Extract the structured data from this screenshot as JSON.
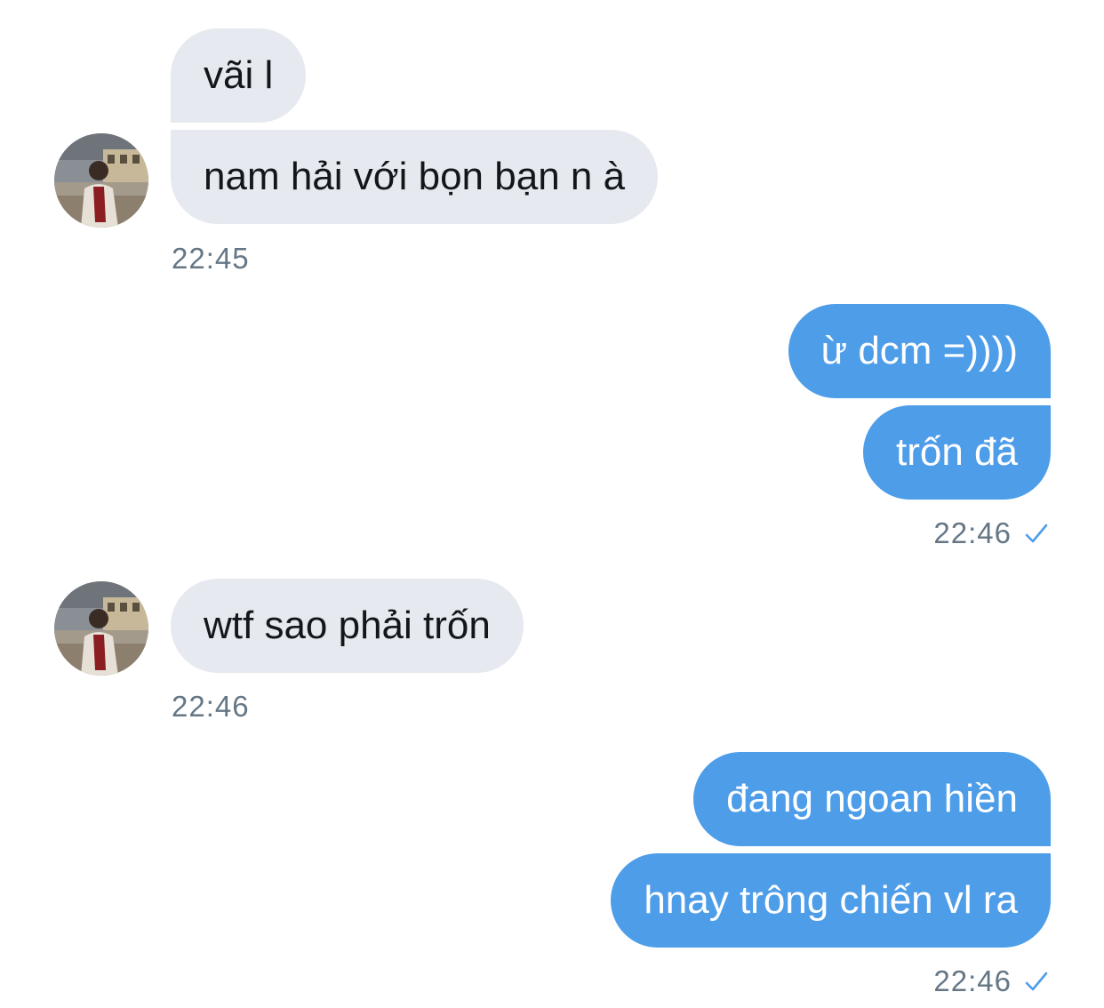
{
  "conversation": {
    "group1": {
      "messages": [
        "vãi l",
        "nam hải với bọn bạn n à"
      ],
      "time": "22:45"
    },
    "group2": {
      "messages": [
        "ừ dcm =))))",
        "trốn đã"
      ],
      "time": "22:46",
      "status_icon": "check-icon"
    },
    "group3": {
      "messages": [
        "wtf sao phải trốn"
      ],
      "time": "22:46"
    },
    "group4": {
      "messages": [
        "đang ngoan hiền",
        "hnay trông chiến vl ra"
      ],
      "time": "22:46",
      "status_icon": "check-icon"
    }
  },
  "colors": {
    "received_bubble": "#e6e9ef",
    "sent_bubble": "#4e9de9",
    "timestamp": "#657786",
    "check": "#4e9de9"
  }
}
